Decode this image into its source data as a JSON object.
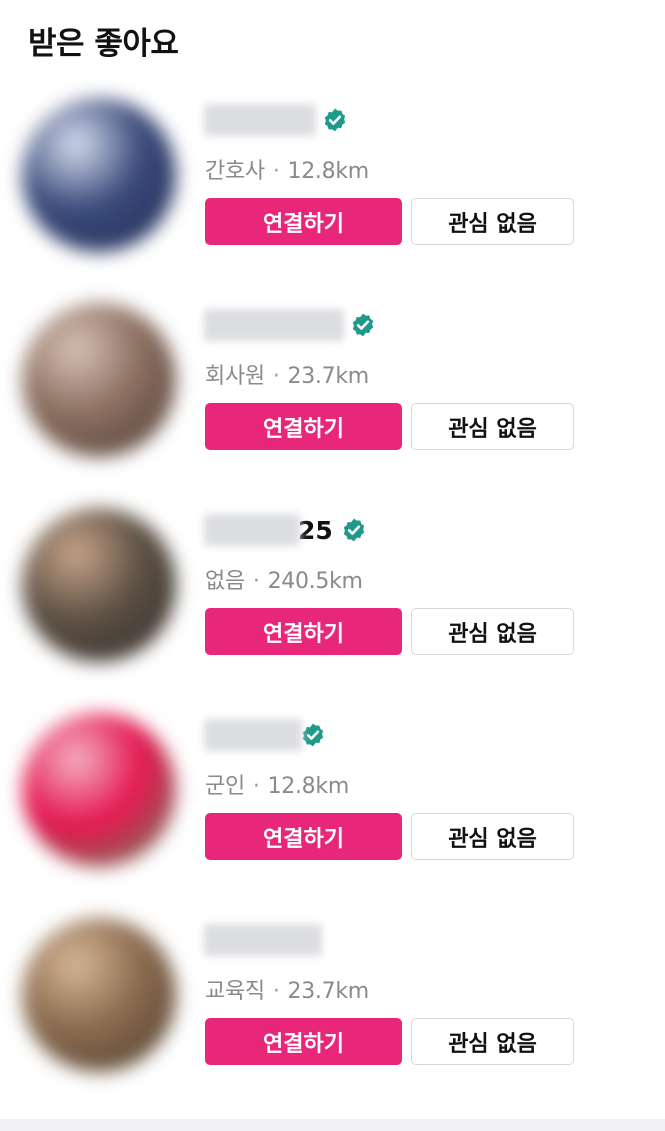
{
  "header": {
    "title": "받은 좋아요"
  },
  "items": [
    {
      "name": "",
      "verified": true,
      "job": "간호사",
      "separator": "·",
      "distance": "12.8km",
      "connect_label": "연결하기",
      "dismiss_label": "관심 없음",
      "avatar_colors": [
        "#3a4a7a",
        "#d8dff0",
        "#1e2a52"
      ]
    },
    {
      "name": "",
      "verified": true,
      "job": "회사원",
      "separator": "·",
      "distance": "23.7km",
      "connect_label": "연결하기",
      "dismiss_label": "관심 없음",
      "avatar_colors": [
        "#8a6e60",
        "#d8c2b4",
        "#4c3a32"
      ]
    },
    {
      "name": "25",
      "verified": true,
      "job": "없음",
      "separator": "·",
      "distance": "240.5km",
      "connect_label": "연결하기",
      "dismiss_label": "관심 없음",
      "avatar_colors": [
        "#5c5044",
        "#c9a58a",
        "#2f2a25"
      ]
    },
    {
      "name": "",
      "verified": true,
      "job": "군인",
      "separator": "·",
      "distance": "12.8km",
      "connect_label": "연결하기",
      "dismiss_label": "관심 없음",
      "avatar_colors": [
        "#e5164f",
        "#f4b3c2",
        "#5a8a5a"
      ]
    },
    {
      "name": "",
      "verified": false,
      "job": "교육직",
      "separator": "·",
      "distance": "23.7km",
      "connect_label": "연결하기",
      "dismiss_label": "관심 없음",
      "avatar_colors": [
        "#8a6a4e",
        "#d7b896",
        "#4a3a2e"
      ]
    }
  ],
  "colors": {
    "accent": "#e8277b",
    "verified": "#1f9a8a",
    "meta_text": "#8a8a8a"
  },
  "icons": {
    "verified": "verified-check-icon"
  }
}
